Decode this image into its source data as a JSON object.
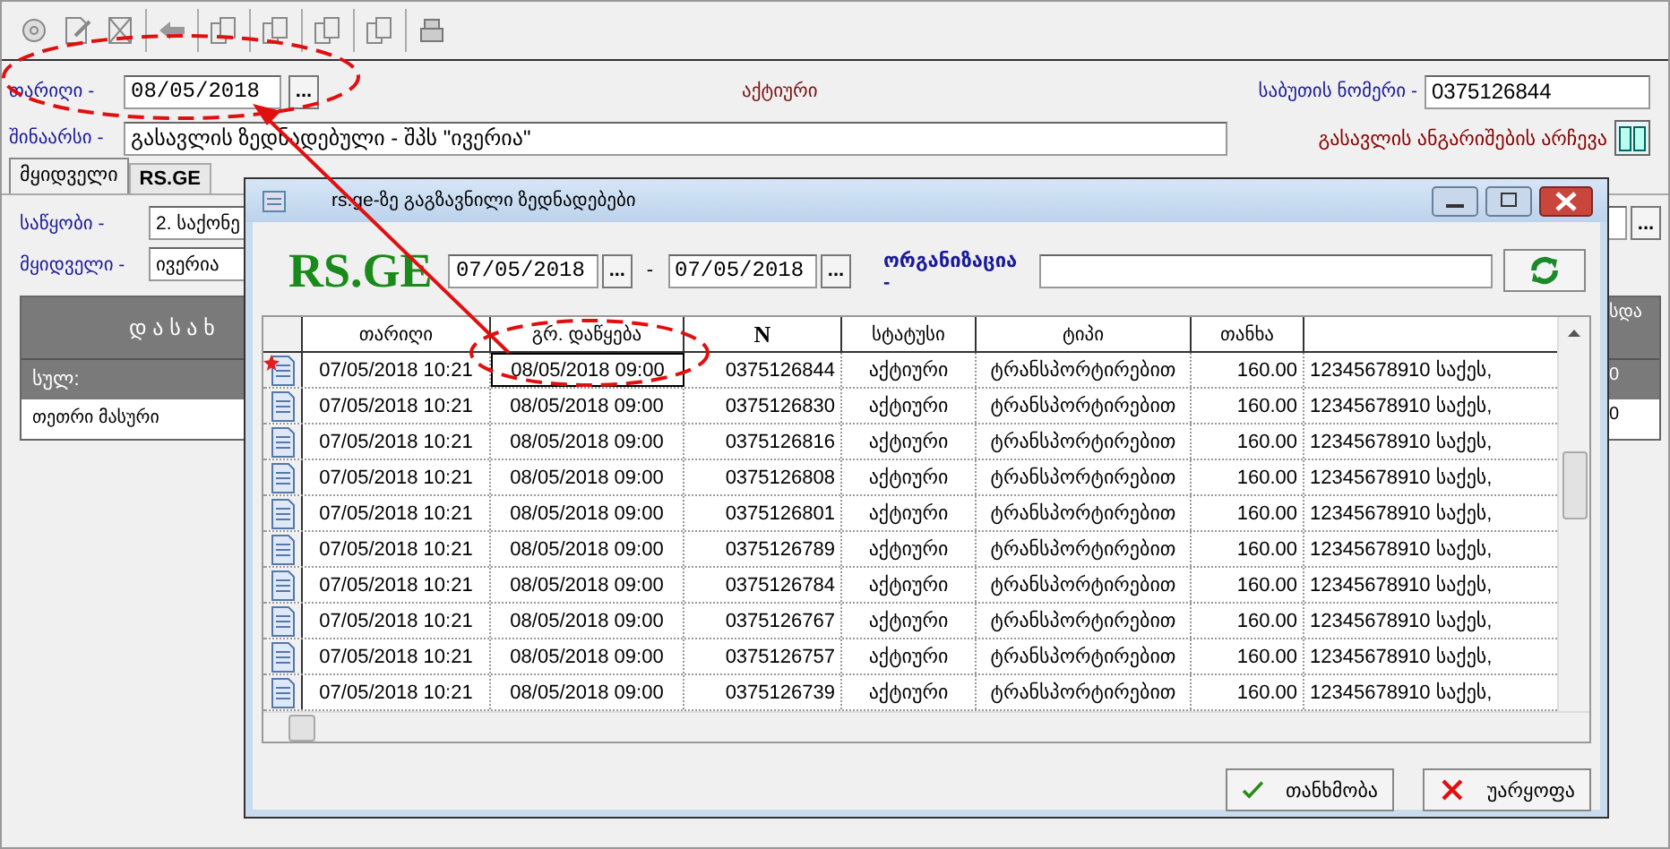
{
  "header": {
    "date_label": "თარიღი -",
    "date_value": "08/05/2018",
    "picker": "...",
    "status": "აქტიური",
    "doc_number_label": "საბუთის ნომერი -",
    "doc_number_value": "0375126844",
    "content_label": "შინაარსი -",
    "content_value": "გასავლის ზედნადებული - შპს \"ივერია\"",
    "accounts_link": "გასავლის ანგარიშების არჩევა"
  },
  "tabs": [
    {
      "label": "მყიდველი",
      "selected": true
    },
    {
      "label": "RS.GE",
      "selected": false
    }
  ],
  "buyer_panel": {
    "warehouse_label": "საწყობი -",
    "warehouse_value": "2. საქონე",
    "picker": "...",
    "buyer_label": "მყიდველი -",
    "buyer_value": "ივერია",
    "grid_title": "დ ა ს ა ხ",
    "side_column": "სდა",
    "total_label": "სულ:",
    "total_value": "0",
    "rows": [
      {
        "name": "თეთრი მასური",
        "value": "0"
      }
    ]
  },
  "dialog": {
    "title": "rs.ge-ზე გაგზავნილი ზედნადებები",
    "logo": "RS.GE",
    "date_from": "07/05/2018",
    "date_to": "07/05/2018",
    "picker": "...",
    "separator": "-",
    "organization_label": "ორგანიზაცია -",
    "columns": [
      "თარიღი",
      "გრ. დაწყება",
      "N",
      "სტატუსი",
      "ტიპი",
      "თანხა"
    ],
    "rows": [
      {
        "current": true,
        "cells": [
          "07/05/2018 10:21",
          "08/05/2018 09:00",
          "0375126844",
          "აქტიური",
          "ტრანსპორტირებით",
          "160.00",
          "12345678910 საქეს,"
        ]
      },
      {
        "current": false,
        "cells": [
          "07/05/2018 10:21",
          "08/05/2018 09:00",
          "0375126830",
          "აქტიური",
          "ტრანსპორტირებით",
          "160.00",
          "12345678910 საქეს,"
        ]
      },
      {
        "current": false,
        "cells": [
          "07/05/2018 10:21",
          "08/05/2018 09:00",
          "0375126816",
          "აქტიური",
          "ტრანსპორტირებით",
          "160.00",
          "12345678910 საქეს,"
        ]
      },
      {
        "current": false,
        "cells": [
          "07/05/2018 10:21",
          "08/05/2018 09:00",
          "0375126808",
          "აქტიური",
          "ტრანსპორტირებით",
          "160.00",
          "12345678910 საქეს,"
        ]
      },
      {
        "current": false,
        "cells": [
          "07/05/2018 10:21",
          "08/05/2018 09:00",
          "0375126801",
          "აქტიური",
          "ტრანსპორტირებით",
          "160.00",
          "12345678910 საქეს,"
        ]
      },
      {
        "current": false,
        "cells": [
          "07/05/2018 10:21",
          "08/05/2018 09:00",
          "0375126789",
          "აქტიური",
          "ტრანსპორტირებით",
          "160.00",
          "12345678910 საქეს,"
        ]
      },
      {
        "current": false,
        "cells": [
          "07/05/2018 10:21",
          "08/05/2018 09:00",
          "0375126784",
          "აქტიური",
          "ტრანსპორტირებით",
          "160.00",
          "12345678910 საქეს,"
        ]
      },
      {
        "current": false,
        "cells": [
          "07/05/2018 10:21",
          "08/05/2018 09:00",
          "0375126767",
          "აქტიური",
          "ტრანსპორტირებით",
          "160.00",
          "12345678910 საქეს,"
        ]
      },
      {
        "current": false,
        "cells": [
          "07/05/2018 10:21",
          "08/05/2018 09:00",
          "0375126757",
          "აქტიური",
          "ტრანსპორტირებით",
          "160.00",
          "12345678910 საქეს,"
        ]
      },
      {
        "current": false,
        "cells": [
          "07/05/2018 10:21",
          "08/05/2018 09:00",
          "0375126739",
          "აქტიური",
          "ტრანსპორტირებით",
          "160.00",
          "12345678910 საქეს,"
        ]
      }
    ],
    "buttons": [
      {
        "label": "თანხმობა",
        "kind": "ok"
      },
      {
        "label": "უარყოფა",
        "kind": "cancel"
      }
    ]
  }
}
